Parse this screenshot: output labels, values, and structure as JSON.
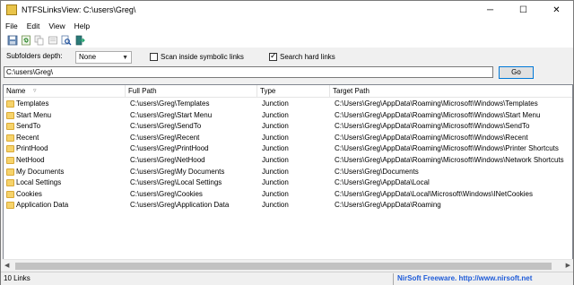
{
  "window": {
    "title": "NTFSLinksView:  C:\\users\\Greg\\",
    "minimize": "─",
    "maximize": "☐",
    "close": "✕"
  },
  "menu": [
    "File",
    "Edit",
    "View",
    "Help"
  ],
  "options": {
    "subfolders_label": "Subfolders depth:",
    "subfolders_value": "None",
    "scan_symbolic_label": "Scan inside symbolic links",
    "scan_symbolic_checked": false,
    "search_hard_label": "Search hard links",
    "search_hard_checked": true
  },
  "path_input": "C:\\users\\Greg\\",
  "go_label": "Go",
  "columns": [
    "Name",
    "Full Path",
    "Type",
    "Target Path"
  ],
  "rows": [
    {
      "name": "Templates",
      "full": "C:\\users\\Greg\\Templates",
      "type": "Junction",
      "target": "C:\\Users\\Greg\\AppData\\Roaming\\Microsoft\\Windows\\Templates"
    },
    {
      "name": "Start Menu",
      "full": "C:\\users\\Greg\\Start Menu",
      "type": "Junction",
      "target": "C:\\Users\\Greg\\AppData\\Roaming\\Microsoft\\Windows\\Start Menu"
    },
    {
      "name": "SendTo",
      "full": "C:\\users\\Greg\\SendTo",
      "type": "Junction",
      "target": "C:\\Users\\Greg\\AppData\\Roaming\\Microsoft\\Windows\\SendTo"
    },
    {
      "name": "Recent",
      "full": "C:\\users\\Greg\\Recent",
      "type": "Junction",
      "target": "C:\\Users\\Greg\\AppData\\Roaming\\Microsoft\\Windows\\Recent"
    },
    {
      "name": "PrintHood",
      "full": "C:\\users\\Greg\\PrintHood",
      "type": "Junction",
      "target": "C:\\Users\\Greg\\AppData\\Roaming\\Microsoft\\Windows\\Printer Shortcuts"
    },
    {
      "name": "NetHood",
      "full": "C:\\users\\Greg\\NetHood",
      "type": "Junction",
      "target": "C:\\Users\\Greg\\AppData\\Roaming\\Microsoft\\Windows\\Network Shortcuts"
    },
    {
      "name": "My Documents",
      "full": "C:\\users\\Greg\\My Documents",
      "type": "Junction",
      "target": "C:\\Users\\Greg\\Documents"
    },
    {
      "name": "Local Settings",
      "full": "C:\\users\\Greg\\Local Settings",
      "type": "Junction",
      "target": "C:\\Users\\Greg\\AppData\\Local"
    },
    {
      "name": "Cookies",
      "full": "C:\\users\\Greg\\Cookies",
      "type": "Junction",
      "target": "C:\\Users\\Greg\\AppData\\Local\\Microsoft\\Windows\\INetCookies"
    },
    {
      "name": "Application Data",
      "full": "C:\\users\\Greg\\Application Data",
      "type": "Junction",
      "target": "C:\\Users\\Greg\\AppData\\Roaming"
    }
  ],
  "status": {
    "count": "10 Links",
    "credit": "NirSoft Freeware.  http://www.nirsoft.net"
  },
  "colors": {
    "folder": "#f6d36b",
    "link": "#1e5bd8",
    "accent": "#0078d7"
  }
}
